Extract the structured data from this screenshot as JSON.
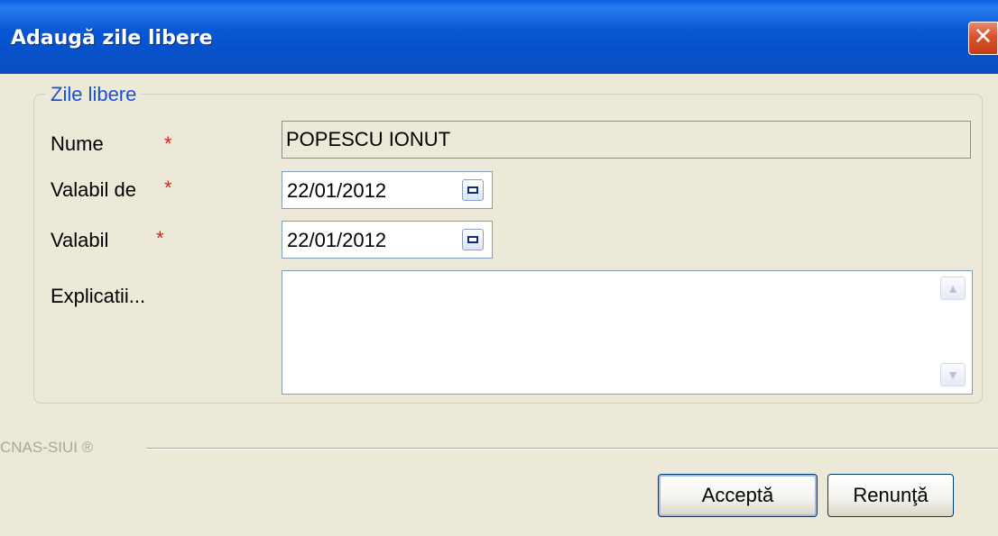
{
  "window": {
    "title": "Adaugă zile libere",
    "close_glyph": "✕"
  },
  "group": {
    "legend": "Zile libere"
  },
  "form": {
    "nume_label": "Nume",
    "nume_value": "POPESCU IONUT",
    "valabil_de_label": "Valabil de",
    "valabil_de_value": "22/01/2012",
    "valabil_label": "Valabil",
    "valabil_value": "22/01/2012",
    "explicatii_label": "Explicatii...",
    "explicatii_value": "",
    "required_marker": "*"
  },
  "footer": {
    "brand": "CNAS-SIUI ®"
  },
  "buttons": {
    "accept": "Acceptă",
    "cancel": "Renunţă"
  },
  "icons": {
    "close": "close-icon",
    "calendar": "calendar-icon",
    "scroll_up": "scroll-up-icon",
    "scroll_down": "scroll-down-icon"
  },
  "colors": {
    "titlebar": "#0a58d6",
    "legend": "#1c4fd8",
    "required": "#e0201c",
    "close": "#d8522c",
    "background": "#ece9d8"
  }
}
